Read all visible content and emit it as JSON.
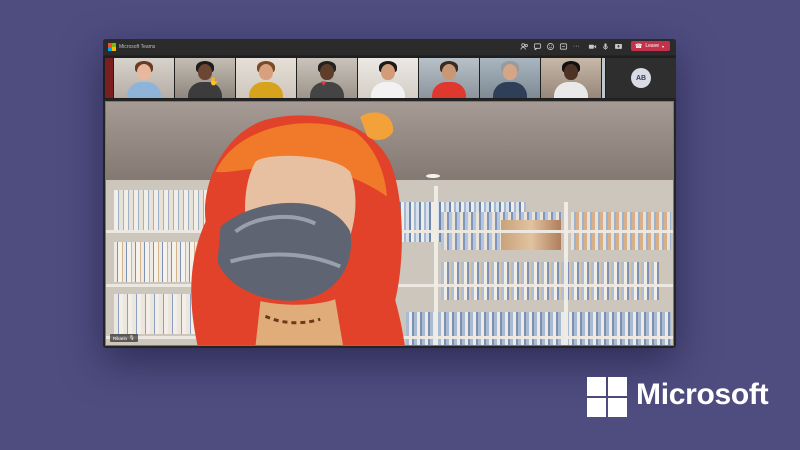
{
  "window": {
    "title": "Microsoft Teams",
    "toolbar": {
      "icons": [
        "people-icon",
        "chat-icon",
        "reactions-icon",
        "share-icon",
        "more-icon",
        "camera-icon",
        "mic-icon",
        "share-screen-icon"
      ],
      "more_label": "···",
      "leave_label": "Leave",
      "leave_color": "#c4314b"
    }
  },
  "participants": {
    "tiles_count": 8,
    "avatar_initials": "AB"
  },
  "main_video": {
    "speaker_name": "Rikarin"
  },
  "brand": {
    "name": "Microsoft",
    "logo_colors": [
      "#ffffff",
      "#ffffff",
      "#ffffff",
      "#ffffff"
    ]
  },
  "colors": {
    "background": "#4f4d80",
    "accent": "#6c6fd0"
  }
}
